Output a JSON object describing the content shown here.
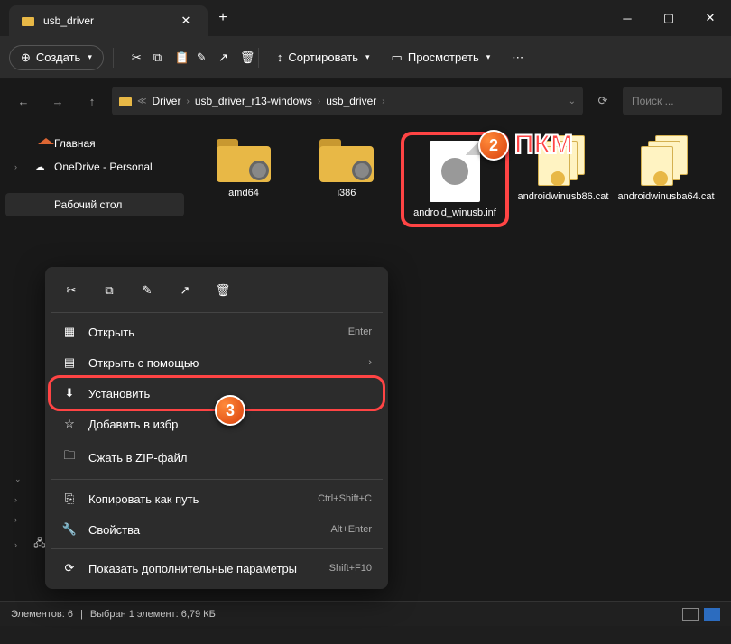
{
  "tab": {
    "title": "usb_driver"
  },
  "toolbar": {
    "create": "Создать",
    "sort": "Сортировать",
    "view": "Просмотреть"
  },
  "breadcrumb": {
    "parts": [
      "Driver",
      "usb_driver_r13-windows",
      "usb_driver"
    ]
  },
  "search": {
    "placeholder": "Поиск ..."
  },
  "sidebar": {
    "home": "Главная",
    "onedrive": "OneDrive - Personal",
    "desktop": "Рабочий стол",
    "network": "Сеть"
  },
  "files": {
    "f1": "amd64",
    "f2": "i386",
    "f3": "android_winusb.inf",
    "f4": "androidwinusb86.cat",
    "f5": "androidwinusba64.cat"
  },
  "context": {
    "open": "Открыть",
    "open_sc": "Enter",
    "open_with": "Открыть с помощью",
    "install": "Установить",
    "favorite": "Добавить в избр",
    "zip": "Сжать в ZIP-файл",
    "copypath": "Копировать как путь",
    "copypath_sc": "Ctrl+Shift+C",
    "props": "Свойства",
    "props_sc": "Alt+Enter",
    "more": "Показать дополнительные параметры",
    "more_sc": "Shift+F10"
  },
  "badges": {
    "pkm": "ПКМ",
    "n2": "2",
    "n3": "3"
  },
  "status": {
    "left": "Элементов: 6",
    "sel": "Выбран 1 элемент: 6,79 КБ"
  }
}
